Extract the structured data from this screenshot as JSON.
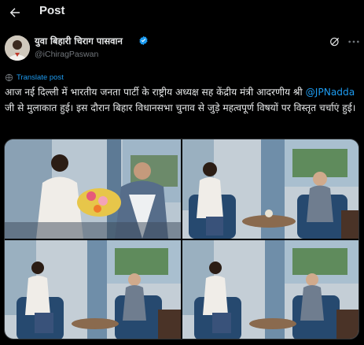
{
  "header": {
    "title": "Post",
    "back_icon": "arrow-left-icon"
  },
  "tweet": {
    "author_name": "युवा बिहारी चिराग पासवान",
    "handle": "@iChiragPaswan",
    "translate_label": "Translate post",
    "text_part1": "आज नई दिल्ली में भारतीय जनता पार्टी के राष्ट्रीय अध्यक्ष सह केंद्रीय मंत्री आदरणीय श्री",
    "mention": "@JPNadda",
    "text_part2": " जी से मुलाकात हुई। इस दौरान बिहार विधानसभा चुनाव से जुड़े महत्वपूर्ण विषयों पर विस्तृत चर्चाएं हुई।"
  },
  "colors": {
    "accent": "#1d9bf0",
    "background": "#000000",
    "text": "#e7e9ea",
    "secondary": "#71767b"
  },
  "icons": [
    "arrow-left-icon",
    "verified-badge-icon",
    "grok-icon",
    "more-icon",
    "translate-icon"
  ]
}
